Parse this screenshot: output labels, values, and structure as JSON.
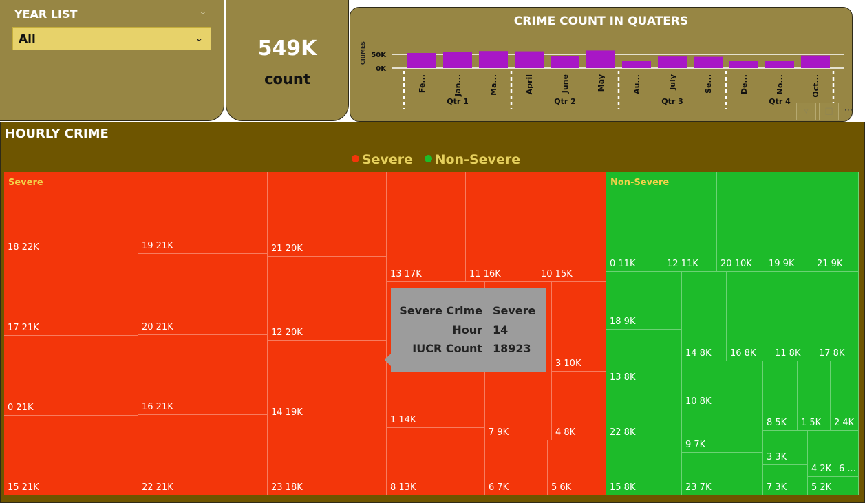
{
  "year_list": {
    "title": "YEAR LIST",
    "selected": "All"
  },
  "kpi": {
    "value": "549K",
    "label": "count"
  },
  "chart_data": {
    "type": "bar",
    "title": "CRIME COUNT IN QUATERS",
    "ylabel": "CRIMES",
    "yticks": [
      "50K",
      "0K"
    ],
    "ylim": [
      0,
      70000
    ],
    "categories": [
      "Fe...",
      "Jan...",
      "Ma...",
      "April",
      "June",
      "May",
      "Au...",
      "July",
      "Se...",
      "De...",
      "No...",
      "Oct..."
    ],
    "values": [
      55000,
      58000,
      62000,
      61000,
      44000,
      64000,
      25000,
      42000,
      41000,
      25000,
      25000,
      46000
    ],
    "groups": [
      {
        "name": "Qtr 1",
        "size": 3
      },
      {
        "name": "Qtr 2",
        "size": 3
      },
      {
        "name": "Qtr 3",
        "size": 3
      },
      {
        "name": "Qtr 4",
        "size": 3
      }
    ],
    "bar_color": "#a817c6"
  },
  "visual_icons": [
    "filter-icon",
    "focus-mode-icon",
    "more-options-icon"
  ],
  "treemap": {
    "title": "HOURLY CRIME",
    "legend": [
      {
        "label": "Severe",
        "color": "#f3360a"
      },
      {
        "label": "Non-Severe",
        "color": "#1dbb2a"
      }
    ],
    "severe_label": "Severe",
    "non_severe_label": "Non-Severe",
    "severe_color": "#f3360a",
    "non_severe_color": "#1dbb2a",
    "severe_cells": [
      "18 22K",
      "17 21K",
      "0 21K",
      "15 21K",
      "19 21K",
      "20 21K",
      "16 21K",
      "22 21K",
      "21 20K",
      "12 20K",
      "14 19K",
      "23 18K",
      "13 17K",
      "1 14K",
      "8 13K",
      "11 16K",
      "10 15K",
      "3 10K",
      "7 9K",
      "4 8K",
      "6 7K",
      "5 6K"
    ],
    "non_severe_cells": [
      "0 11K",
      "12 11K",
      "20 10K",
      "19 9K",
      "21 9K",
      "18 9K",
      "13 8K",
      "22 8K",
      "15 8K",
      "14 8K",
      "16 8K",
      "11 8K",
      "17 8K",
      "10 8K",
      "9 7K",
      "23 7K",
      "8 5K",
      "1 5K",
      "2 4K",
      "3 3K",
      "4 2K",
      "6 ...",
      "7 3K",
      "5 2K"
    ]
  },
  "tooltip": {
    "rows": [
      {
        "key": "Severe Crime",
        "value": "Severe"
      },
      {
        "key": "Hour",
        "value": "14"
      },
      {
        "key": "IUCR Count",
        "value": "18923"
      }
    ]
  }
}
